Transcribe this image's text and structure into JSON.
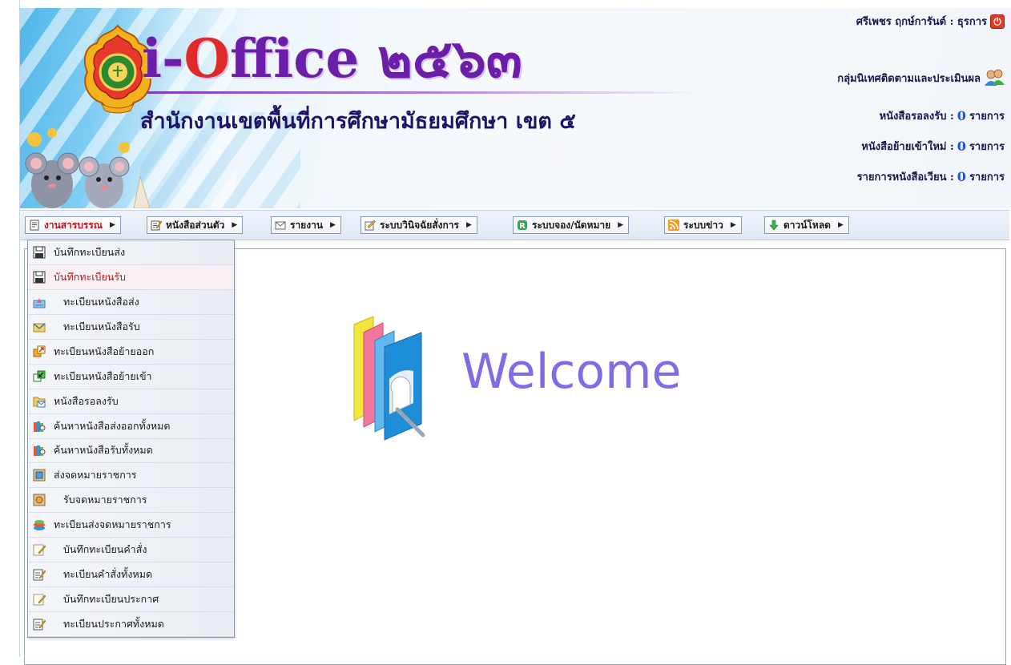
{
  "header": {
    "brand_prefix": "i-",
    "brand_accent": "O",
    "brand_suffix": "ffice ๒๕๖๓",
    "organization": "สำนักงานเขตพื้นที่การศึกษามัธยมศึกษา เขต ๕",
    "user_name": "ศรีเพชร ฤกษ์การันต์ : ธุรการ",
    "group_name": "กลุ่มนิเทศติดตามและประเมินผล",
    "counts": [
      {
        "label": "หนังสือรอลงรับ : ",
        "value": "0",
        "unit": " รายการ"
      },
      {
        "label": "หนังสือย้ายเข้าใหม่ : ",
        "value": "0",
        "unit": " รายการ"
      },
      {
        "label": "รายการหนังสือเวียน : ",
        "value": "0",
        "unit": " รายการ"
      }
    ]
  },
  "menu": [
    {
      "label": "งานสารบรรณ",
      "icon": "document-icon"
    },
    {
      "label": "หนังสือส่วนตัว",
      "icon": "edit-document-icon"
    },
    {
      "label": "รายงาน",
      "icon": "envelope-icon"
    },
    {
      "label": "ระบบวินิจฉัยสั่งการ",
      "icon": "pencil-note-icon"
    },
    {
      "label": "ระบบจอง/นัดหมาย",
      "icon": "booking-icon"
    },
    {
      "label": "ระบบข่าว",
      "icon": "rss-icon"
    },
    {
      "label": "ดาวน์โหลด",
      "icon": "download-icon"
    }
  ],
  "dropdown": [
    {
      "label": "บันทึกทะเบียนส่ง",
      "icon": "save-icon"
    },
    {
      "label": "บันทึกทะเบียนรับ",
      "icon": "save-icon"
    },
    {
      "label": "ทะเบียนหนังสือส่ง",
      "icon": "outbox-icon"
    },
    {
      "label": "ทะเบียนหนังสือรับ",
      "icon": "inbox-mail-icon"
    },
    {
      "label": "ทะเบียนหนังสือย้ายออก",
      "icon": "move-out-icon"
    },
    {
      "label": "ทะเบียนหนังสือย้ายเข้า",
      "icon": "move-in-icon"
    },
    {
      "label": "หนังสือรอลงรับ",
      "icon": "folder-mail-icon"
    },
    {
      "label": "ค้นหาหนังสือส่งออกทั้งหมด",
      "icon": "books-search-icon"
    },
    {
      "label": "ค้นหาหนังสือรับทั้งหมด",
      "icon": "books-search-icon"
    },
    {
      "label": "ส่งจดหมายราชการ",
      "icon": "letter-send-icon"
    },
    {
      "label": "รับจดหมายราชการ",
      "icon": "letter-receive-icon"
    },
    {
      "label": "ทะเบียนส่งจดหมายราชการ",
      "icon": "books-stack-icon"
    },
    {
      "label": "บันทึกทะเบียนคำสั่ง",
      "icon": "note-pencil-icon"
    },
    {
      "label": "ทะเบียนคำสั่งทั้งหมด",
      "icon": "edit-document-icon"
    },
    {
      "label": "บันทึกทะเบียนประกาศ",
      "icon": "note-pencil-icon"
    },
    {
      "label": "ทะเบียนประกาศทั้งหมด",
      "icon": "edit-document-icon"
    }
  ],
  "welcome": {
    "text": "Welcome"
  }
}
